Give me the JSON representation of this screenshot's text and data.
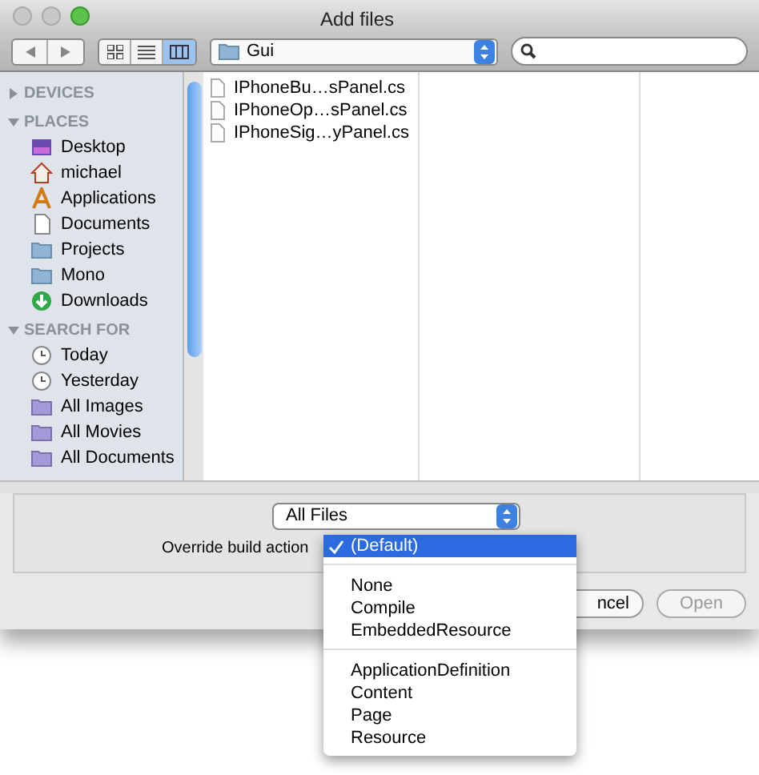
{
  "window": {
    "title": "Add files"
  },
  "toolbar": {
    "view_modes": [
      {
        "kind": "icons",
        "selected": false
      },
      {
        "kind": "list",
        "selected": false
      },
      {
        "kind": "columns",
        "selected": true
      }
    ],
    "location": "Gui"
  },
  "sidebar": {
    "sections": [
      {
        "title": "DEVICES",
        "expanded": false
      },
      {
        "title": "PLACES",
        "expanded": true,
        "items": [
          {
            "label": "Desktop",
            "kind": "desktop"
          },
          {
            "label": "michael",
            "kind": "home"
          },
          {
            "label": "Applications",
            "kind": "apps"
          },
          {
            "label": "Documents",
            "kind": "document"
          },
          {
            "label": "Projects",
            "kind": "folder"
          },
          {
            "label": "Mono",
            "kind": "folder"
          },
          {
            "label": "Downloads",
            "kind": "download"
          }
        ]
      },
      {
        "title": "SEARCH FOR",
        "expanded": true,
        "items": [
          {
            "label": "Today",
            "kind": "clock"
          },
          {
            "label": "Yesterday",
            "kind": "clock"
          },
          {
            "label": "All Images",
            "kind": "smartfolder"
          },
          {
            "label": "All Movies",
            "kind": "smartfolder"
          },
          {
            "label": "All Documents",
            "kind": "smartfolder"
          }
        ]
      }
    ]
  },
  "files": [
    "IPhoneBu…sPanel.cs",
    "IPhoneOp…sPanel.cs",
    "IPhoneSig…yPanel.cs"
  ],
  "filter": {
    "value": "All Files"
  },
  "build_action": {
    "label": "Override build action"
  },
  "buttons": [
    {
      "label": "ncel",
      "disabled": false
    },
    {
      "label": "Open",
      "disabled": true
    }
  ],
  "menu": {
    "groups": [
      [
        {
          "label": "(Default)",
          "selected": true
        }
      ],
      [
        {
          "label": "None",
          "selected": false
        },
        {
          "label": "Compile",
          "selected": false
        },
        {
          "label": "EmbeddedResource",
          "selected": false
        }
      ],
      [
        {
          "label": "ApplicationDefinition",
          "selected": false
        },
        {
          "label": "Content",
          "selected": false
        },
        {
          "label": "Page",
          "selected": false
        },
        {
          "label": "Resource",
          "selected": false
        }
      ]
    ]
  }
}
